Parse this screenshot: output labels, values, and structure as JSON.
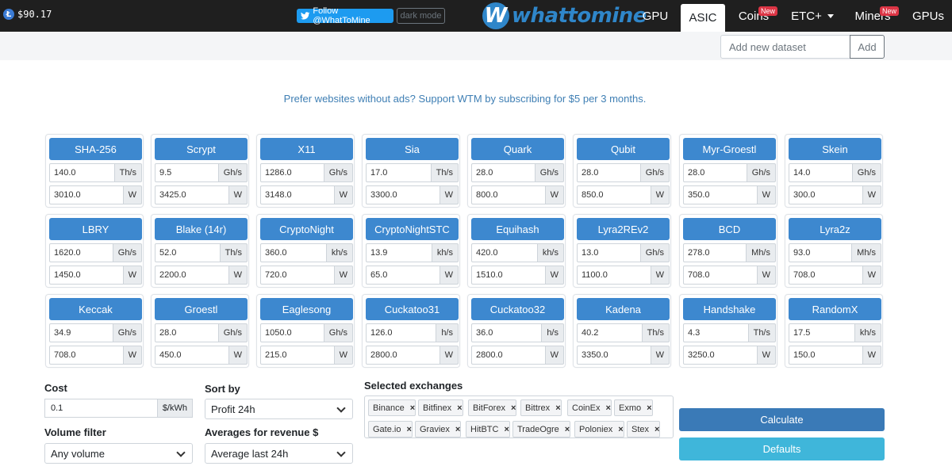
{
  "topbar": {
    "ltc_symbol": "Ł",
    "ltc_price": "$90.17",
    "twitter_label": "Follow @WhatToMine",
    "dark_mode_label": "dark mode",
    "logo_letter": "W",
    "logo_text": "whattomine"
  },
  "nav": {
    "gpu": "GPU",
    "asic": "ASIC",
    "coins": "Coins",
    "coins_badge": "New",
    "etc": "ETC+",
    "miners": "Miners",
    "miners_badge": "New",
    "gpus": "GPUs"
  },
  "dataset": {
    "placeholder": "Add new dataset",
    "add_label": "Add"
  },
  "promo_text": "Prefer websites without ads? Support WTM by subscribing for $5 per 3 months.",
  "algos": [
    {
      "name": "SHA-256",
      "hashrate": "140.0",
      "unit": "Th/s",
      "power": "3010.0",
      "power_unit": "W"
    },
    {
      "name": "Scrypt",
      "hashrate": "9.5",
      "unit": "Gh/s",
      "power": "3425.0",
      "power_unit": "W"
    },
    {
      "name": "X11",
      "hashrate": "1286.0",
      "unit": "Gh/s",
      "power": "3148.0",
      "power_unit": "W"
    },
    {
      "name": "Sia",
      "hashrate": "17.0",
      "unit": "Th/s",
      "power": "3300.0",
      "power_unit": "W"
    },
    {
      "name": "Quark",
      "hashrate": "28.0",
      "unit": "Gh/s",
      "power": "800.0",
      "power_unit": "W"
    },
    {
      "name": "Qubit",
      "hashrate": "28.0",
      "unit": "Gh/s",
      "power": "850.0",
      "power_unit": "W"
    },
    {
      "name": "Myr-Groestl",
      "hashrate": "28.0",
      "unit": "Gh/s",
      "power": "350.0",
      "power_unit": "W"
    },
    {
      "name": "Skein",
      "hashrate": "14.0",
      "unit": "Gh/s",
      "power": "300.0",
      "power_unit": "W"
    },
    {
      "name": "LBRY",
      "hashrate": "1620.0",
      "unit": "Gh/s",
      "power": "1450.0",
      "power_unit": "W"
    },
    {
      "name": "Blake (14r)",
      "hashrate": "52.0",
      "unit": "Th/s",
      "power": "2200.0",
      "power_unit": "W"
    },
    {
      "name": "CryptoNight",
      "hashrate": "360.0",
      "unit": "kh/s",
      "power": "720.0",
      "power_unit": "W"
    },
    {
      "name": "CryptoNightSTC",
      "hashrate": "13.9",
      "unit": "kh/s",
      "power": "65.0",
      "power_unit": "W"
    },
    {
      "name": "Equihash",
      "hashrate": "420.0",
      "unit": "kh/s",
      "power": "1510.0",
      "power_unit": "W"
    },
    {
      "name": "Lyra2REv2",
      "hashrate": "13.0",
      "unit": "Gh/s",
      "power": "1100.0",
      "power_unit": "W"
    },
    {
      "name": "BCD",
      "hashrate": "278.0",
      "unit": "Mh/s",
      "power": "708.0",
      "power_unit": "W"
    },
    {
      "name": "Lyra2z",
      "hashrate": "93.0",
      "unit": "Mh/s",
      "power": "708.0",
      "power_unit": "W"
    },
    {
      "name": "Keccak",
      "hashrate": "34.9",
      "unit": "Gh/s",
      "power": "708.0",
      "power_unit": "W"
    },
    {
      "name": "Groestl",
      "hashrate": "28.0",
      "unit": "Gh/s",
      "power": "450.0",
      "power_unit": "W"
    },
    {
      "name": "Eaglesong",
      "hashrate": "1050.0",
      "unit": "Gh/s",
      "power": "215.0",
      "power_unit": "W"
    },
    {
      "name": "Cuckatoo31",
      "hashrate": "126.0",
      "unit": "h/s",
      "power": "2800.0",
      "power_unit": "W"
    },
    {
      "name": "Cuckatoo32",
      "hashrate": "36.0",
      "unit": "h/s",
      "power": "2800.0",
      "power_unit": "W"
    },
    {
      "name": "Kadena",
      "hashrate": "40.2",
      "unit": "Th/s",
      "power": "3350.0",
      "power_unit": "W"
    },
    {
      "name": "Handshake",
      "hashrate": "4.3",
      "unit": "Th/s",
      "power": "3250.0",
      "power_unit": "W"
    },
    {
      "name": "RandomX",
      "hashrate": "17.5",
      "unit": "kh/s",
      "power": "150.0",
      "power_unit": "W"
    }
  ],
  "controls": {
    "cost_label": "Cost",
    "cost_value": "0.1",
    "cost_unit": "$/kWh",
    "sort_label": "Sort by",
    "sort_value": "Profit 24h",
    "volume_label": "Volume filter",
    "volume_value": "Any volume",
    "averages_label": "Averages for revenue $",
    "averages_value": "Average last 24h",
    "exchanges_label": "Selected exchanges",
    "calculate_label": "Calculate",
    "defaults_label": "Defaults"
  },
  "exchanges": [
    "Binance",
    "Bitfinex",
    "BitForex",
    "Bittrex",
    "CoinEx",
    "Exmo",
    "Gate.io",
    "Graviex",
    "HitBTC",
    "TradeOgre",
    "Poloniex",
    "Stex"
  ],
  "colors": {
    "navbar": "#1f1f1f",
    "algo_button": "#3d88cf",
    "calculate": "#3a7ab7",
    "defaults": "#3fb6da",
    "badge": "#dc3545",
    "twitter": "#1d9bf0"
  }
}
